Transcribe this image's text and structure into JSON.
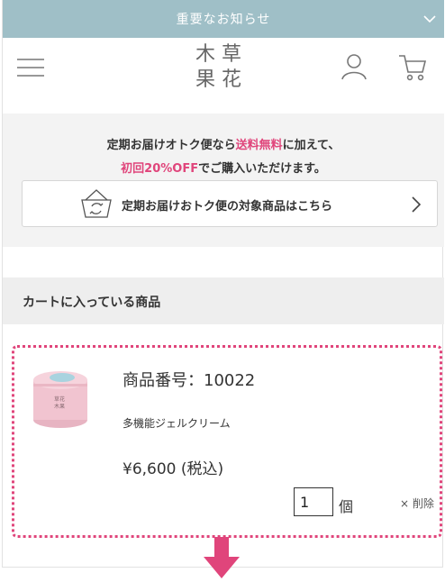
{
  "notice": {
    "label": "重要なお知らせ",
    "icon": "chevron-down-icon"
  },
  "header": {
    "logo_chars": [
      "木",
      "草",
      "果",
      "花"
    ],
    "menu_icon": "hamburger-menu-icon",
    "user_icon": "user-icon",
    "cart_icon": "cart-icon"
  },
  "promo": {
    "line1_prefix": "定期お届けオトク便なら",
    "line1_highlight": "送料無料",
    "line1_suffix": "に加えて、",
    "line2_highlight": "初回20%OFF",
    "line2_suffix": "でご購入いただけます。",
    "link_label": "定期お届けおトク便の対象商品はこちら",
    "link_icon": "basket-icon"
  },
  "cart": {
    "heading": "カートに入っている商品",
    "item": {
      "number_label": "商品番号：10022",
      "name": "多機能ジェルクリーム",
      "price": "¥6,600 (税込)",
      "quantity": "1",
      "unit": "個",
      "delete_label": "× 削除"
    }
  },
  "colors": {
    "accent_pink": "#e0457b",
    "notice_bar": "#9fbfc7"
  }
}
